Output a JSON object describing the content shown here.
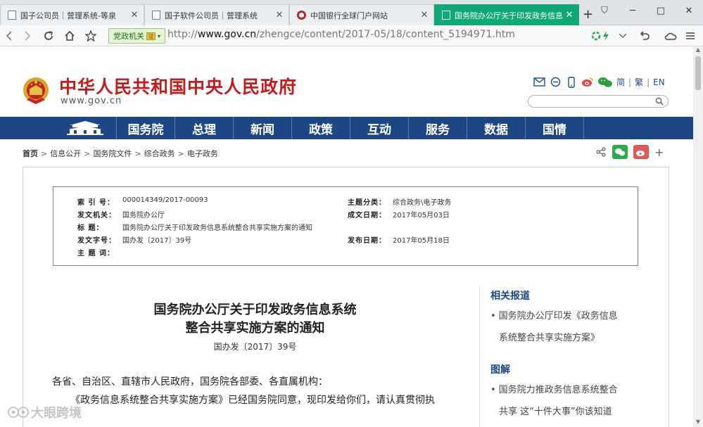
{
  "browser": {
    "tabs": [
      {
        "title": "国子公司员｜营理系统-等泉",
        "active": false
      },
      {
        "title": "国子软件公司员｜营理系统",
        "active": false
      },
      {
        "title": "中国银行全球门户网站",
        "active": false
      },
      {
        "title": "国务院办公厅关于印发政务信息",
        "active": true
      }
    ],
    "new_tab": "+",
    "window_buttons": {
      "shirt": "⛉",
      "minimize": "─",
      "maximize": "□",
      "close": "✕"
    },
    "address": {
      "badge": "党政机关",
      "url_prefix": "http://",
      "url_host": "www.gov.cn",
      "url_path": "/zhengce/content/2017-05/18/content_5194971.htm"
    }
  },
  "site": {
    "title": "中华人民共和国中央人民政府",
    "domain": "www.gov.cn",
    "lang_links": [
      "简",
      "繁",
      "EN"
    ],
    "nav": [
      "国务院",
      "总理",
      "新闻",
      "政策",
      "互动",
      "服务",
      "数据",
      "国情"
    ]
  },
  "breadcrumb": [
    "首页",
    "信息公开",
    "国务院文件",
    "综合政务",
    "电子政务"
  ],
  "meta": {
    "index_key": "索 引 号：",
    "index_val": "000014349/2017-00093",
    "org_key": "发文机关：",
    "org_val": "国务院办公厅",
    "title_key": "标      题：",
    "title_val": "国务院办公厅关于印发政务信息系统整合共享实施方案的通知",
    "docno_key": "发文字号：",
    "docno_val": "国办发〔2017〕39号",
    "subject_key": "主 题 词：",
    "subject_val": "",
    "category_key": "主题分类：",
    "category_val": "综合政务\\电子政务",
    "date_key": "成文日期：",
    "date_val": "2017年05月03日",
    "pub_key": "发布日期：",
    "pub_val": "2017年05月18日"
  },
  "article": {
    "title_line1": "国务院办公厅关于印发政务信息系统",
    "title_line2": "整合共享实施方案的通知",
    "doc_no": "国办发〔2017〕39号",
    "para1": "各省、自治区、直辖市人民政府，国务院各部委、各直属机构：",
    "para2": "《政务信息系统整合共享实施方案》已经国务院同意，现印发给你们，请认真贯彻执"
  },
  "sidebar": {
    "related_heading": "相关报道",
    "related_line1": "国务院办公厅印发《政务信息",
    "related_line2": "系统整合共享实施方案》",
    "illustration_heading": "图解",
    "illus_line1": "国务院力推政务信息系统整合",
    "illus_line2": "共享 这“十件大事”你该知道"
  },
  "watermark": "大眼跨境",
  "colors": {
    "nav_bg": "#1c4784",
    "title_red": "#c21b1b",
    "tab_active": "#11a877"
  }
}
